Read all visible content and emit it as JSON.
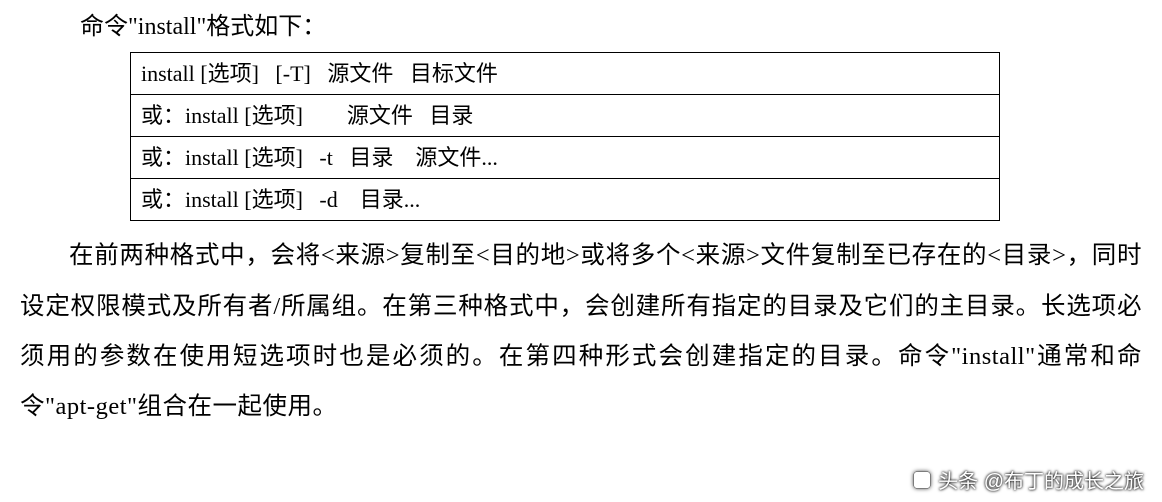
{
  "intro": "命令\"install\"格式如下：",
  "syntax": {
    "rows": [
      "install [选项]   [-T]   源文件   目标文件",
      "或：install [选项]        源文件   目录",
      "或：install [选项]   -t   目录    源文件...",
      "或：install [选项]   -d    目录..."
    ]
  },
  "body": "在前两种格式中，会将<来源>复制至<目的地>或将多个<来源>文件复制至已存在的<目录>，同时设定权限模式及所有者/所属组。在第三种格式中，会创建所有指定的目录及它们的主目录。长选项必须用的参数在使用短选项时也是必须的。在第四种形式会创建指定的目录。命令\"install\"通常和命令\"apt-get\"组合在一起使用。",
  "watermark": "头条 @布丁的成长之旅"
}
